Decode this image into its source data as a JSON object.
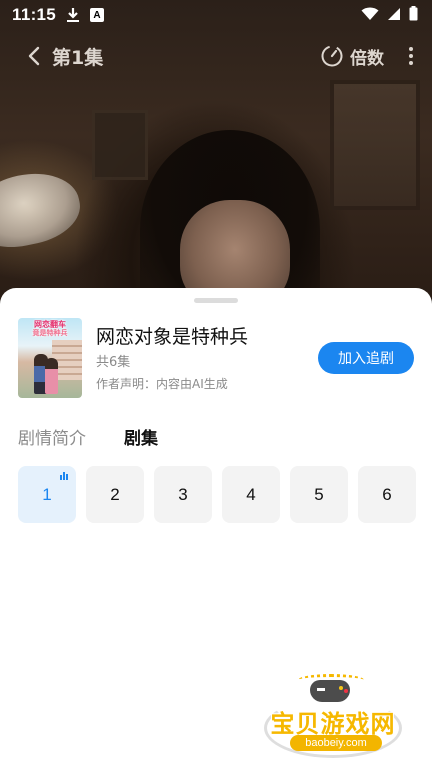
{
  "status_bar": {
    "time": "11:15",
    "icons": [
      "download-icon",
      "a-app-icon",
      "wifi-icon",
      "signal-icon",
      "battery-icon"
    ]
  },
  "player": {
    "episode_title": "第1集",
    "speed_label": "倍数"
  },
  "sheet": {
    "drama_title": "网恋对象是特种兵",
    "episode_count": "共6集",
    "author_note": "作者声明：内容由AI生成",
    "follow_button": "加入追剧",
    "cover_text_1": "网恋翻车",
    "cover_text_2": "竟是特种兵"
  },
  "tabs": [
    {
      "label": "剧情简介",
      "active": false
    },
    {
      "label": "剧集",
      "active": true
    }
  ],
  "episodes": [
    "1",
    "2",
    "3",
    "4",
    "5",
    "6"
  ],
  "selected_episode": "1",
  "watermark": {
    "text": "宝贝游戏网",
    "url": "baobeiy.com"
  },
  "colors": {
    "accent": "#1b86f0",
    "selected_bg": "#e5f1fc",
    "watermark": "#f6b800"
  }
}
